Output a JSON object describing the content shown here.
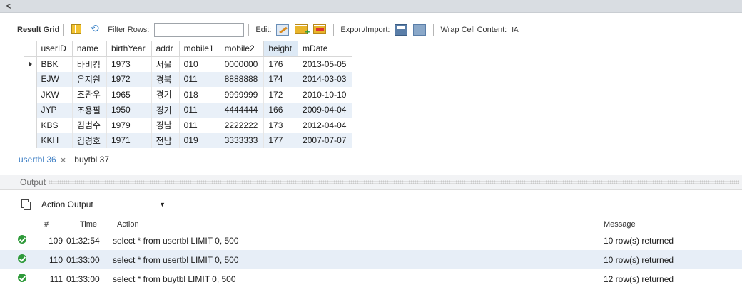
{
  "topbar": {
    "back_glyph": "<"
  },
  "toolbar": {
    "result_grid": "Result Grid",
    "filter_rows": "Filter Rows:",
    "filter_value": "",
    "edit": "Edit:",
    "export_import": "Export/Import:",
    "wrap_cell": "Wrap Cell Content:",
    "wrap_glyph": "I̲A"
  },
  "grid": {
    "columns": [
      "userID",
      "name",
      "birthYear",
      "addr",
      "mobile1",
      "mobile2",
      "height",
      "mDate"
    ],
    "selected_column": "height",
    "rows": [
      [
        "BBK",
        "바비킴",
        "1973",
        "서울",
        "010",
        "0000000",
        "176",
        "2013-05-05"
      ],
      [
        "EJW",
        "은지원",
        "1972",
        "경북",
        "011",
        "8888888",
        "174",
        "2014-03-03"
      ],
      [
        "JKW",
        "조관우",
        "1965",
        "경기",
        "018",
        "9999999",
        "172",
        "2010-10-10"
      ],
      [
        "JYP",
        "조용필",
        "1950",
        "경기",
        "011",
        "4444444",
        "166",
        "2009-04-04"
      ],
      [
        "KBS",
        "김범수",
        "1979",
        "경남",
        "011",
        "2222222",
        "173",
        "2012-04-04"
      ],
      [
        "KKH",
        "김경호",
        "1971",
        "전남",
        "019",
        "3333333",
        "177",
        "2007-07-07"
      ]
    ],
    "current_row_index": 0
  },
  "tabs": [
    {
      "label": "usertbl 36",
      "active": true,
      "close": "×"
    },
    {
      "label": "buytbl 37",
      "active": false
    }
  ],
  "output": {
    "header": "Output",
    "selector_value": "Action Output",
    "columns": {
      "num": "#",
      "time": "Time",
      "action": "Action",
      "message": "Message"
    },
    "rows": [
      {
        "num": "109",
        "time": "01:32:54",
        "action": "select * from usertbl LIMIT 0, 500",
        "message": "10 row(s) returned",
        "status": "ok"
      },
      {
        "num": "110",
        "time": "01:33:00",
        "action": "select * from usertbl LIMIT 0, 500",
        "message": "10 row(s) returned",
        "status": "ok"
      },
      {
        "num": "111",
        "time": "01:33:00",
        "action": "select * from buytbl LIMIT 0, 500",
        "message": "12 row(s) returned",
        "status": "ok"
      }
    ]
  },
  "colors": {
    "row_alt": "#e9f0f8",
    "selected_header": "#dde9f5",
    "ok": "#2e9a3a",
    "tab_active": "#3d7ec4"
  }
}
